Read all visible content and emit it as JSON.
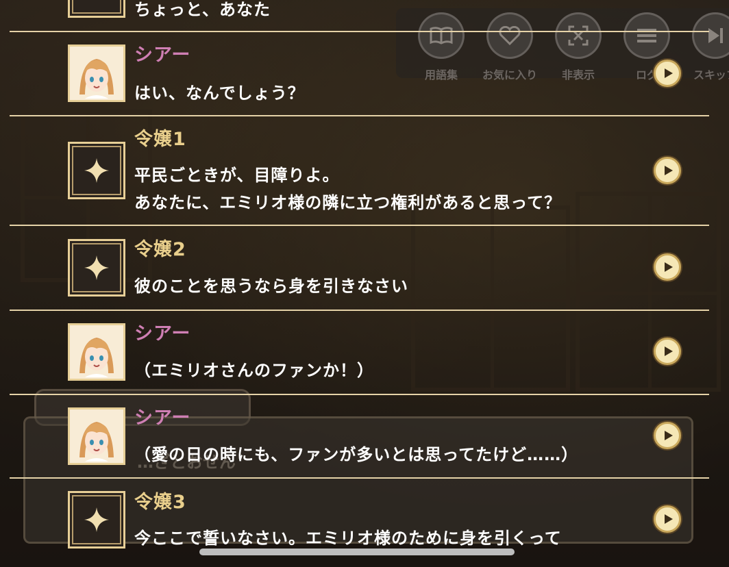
{
  "toolbar": {
    "buttons": [
      {
        "label": "用語集",
        "icon": "book-icon"
      },
      {
        "label": "お気に入り",
        "icon": "heart-icon"
      },
      {
        "label": "非表示",
        "icon": "hide-icon"
      },
      {
        "label": "ログ",
        "icon": "menu-icon"
      },
      {
        "label": "スキップ",
        "icon": "skip-icon"
      }
    ]
  },
  "underlying": {
    "partial_text": "…ざとおせん"
  },
  "log": {
    "top_partial_line": "ちょっと、あなた",
    "entries": [
      {
        "speaker": "シアー",
        "speaker_color": "#cf7fb4",
        "portrait": "shear-portrait",
        "lines": [
          "はい、なんでしょう？"
        ]
      },
      {
        "speaker": "令嬢1",
        "speaker_color": "#e9cf8c",
        "portrait": "sparkle-icon",
        "lines": [
          "平民ごときが、目障りよ。",
          "あなたに、エミリオ様の隣に立つ権利があると思って？"
        ]
      },
      {
        "speaker": "令嬢2",
        "speaker_color": "#e9cf8c",
        "portrait": "sparkle-icon",
        "lines": [
          "彼のことを思うなら身を引きなさい"
        ]
      },
      {
        "speaker": "シアー",
        "speaker_color": "#cf7fb4",
        "portrait": "shear-portrait",
        "lines": [
          "（エミリオさんのファンか！）"
        ]
      },
      {
        "speaker": "シアー",
        "speaker_color": "#cf7fb4",
        "portrait": "shear-portrait",
        "lines": [
          "（愛の日の時にも、ファンが多いとは思ってたけど……）"
        ]
      },
      {
        "speaker": "令嬢3",
        "speaker_color": "#e9cf8c",
        "portrait": "sparkle-icon",
        "lines": [
          "今ここで誓いなさい。エミリオ様のために身を引くって"
        ]
      }
    ]
  }
}
